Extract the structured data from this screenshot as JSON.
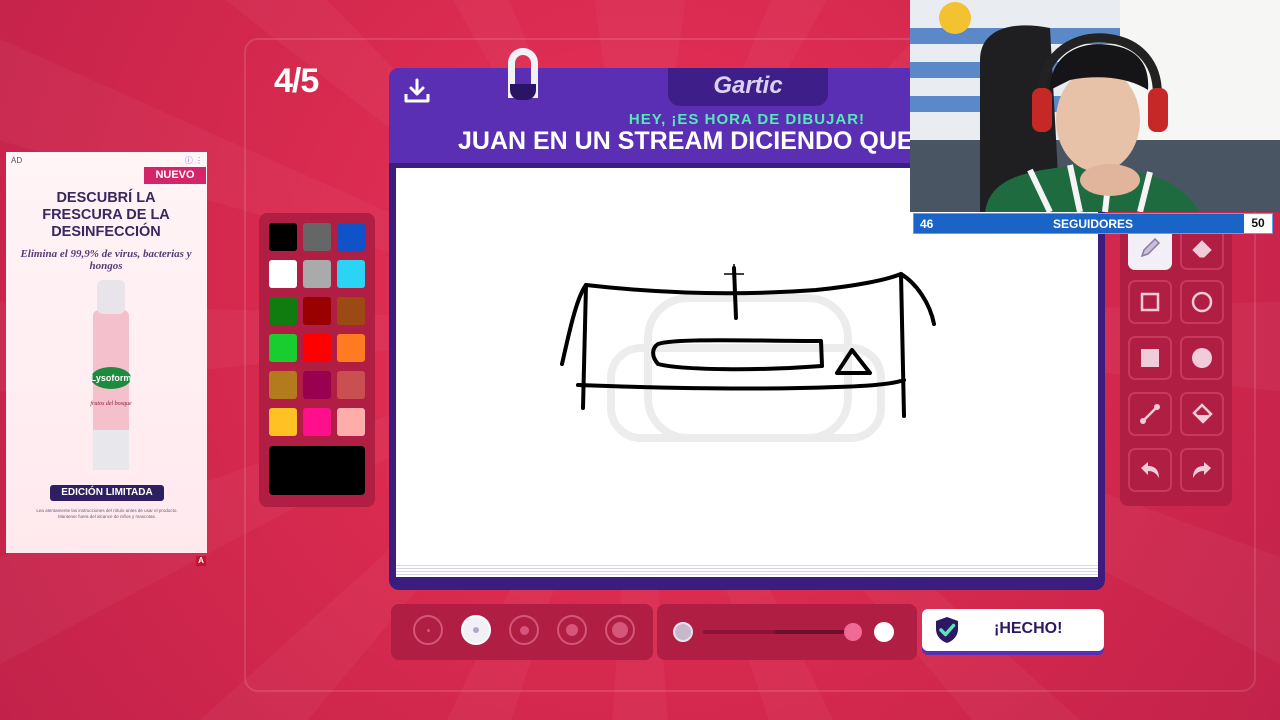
{
  "game": {
    "round": "4/5",
    "logo": "Gartic",
    "hey_text": "HEY, ¡ES HORA DE DIBUJAR!",
    "prompt": "JUAN EN UN STREAM DICIENDO QUE",
    "done_label": "¡HECHO!",
    "current_color": "#000000",
    "palette": [
      "#000000",
      "#666666",
      "#1052c8",
      "#ffffff",
      "#aaaaaa",
      "#2bd3f5",
      "#107c10",
      "#990000",
      "#9c4a14",
      "#19cc30",
      "#ff0000",
      "#ff7a21",
      "#b47a1e",
      "#990050",
      "#c94f52",
      "#ffc124",
      "#ff0f8b",
      "#ffadab"
    ],
    "brush_sizes_selected_index": 1,
    "icons": {
      "download": "download-icon",
      "pencil": "pencil-icon",
      "eraser": "eraser-icon",
      "rect_outline": "rectangle-outline-icon",
      "circle_outline": "circle-outline-icon",
      "rect_fill": "rectangle-filled-icon",
      "circle_fill": "circle-filled-icon",
      "line": "line-icon",
      "bucket": "fill-bucket-icon",
      "undo": "undo-icon",
      "redo": "redo-icon"
    }
  },
  "ad": {
    "label": "AD",
    "badge": "NUEVO",
    "title": "DESCUBRÍ LA FRESCURA DE LA DESINFECCIÓN",
    "subtitle": "Elimina el 99,9% de virus, bacterias y hongos",
    "brand": "Lysoform",
    "product": "frutos del bosque",
    "cta": "EDICIÓN LIMITADA",
    "fine_print": "Lea atentamente las instrucciones del rótulo antes de usar el producto. Mantener fuera del alcance de niños y mascotas."
  },
  "stream": {
    "followers_current": "46",
    "followers_label": "SEGUIDORES",
    "followers_goal": "50"
  }
}
